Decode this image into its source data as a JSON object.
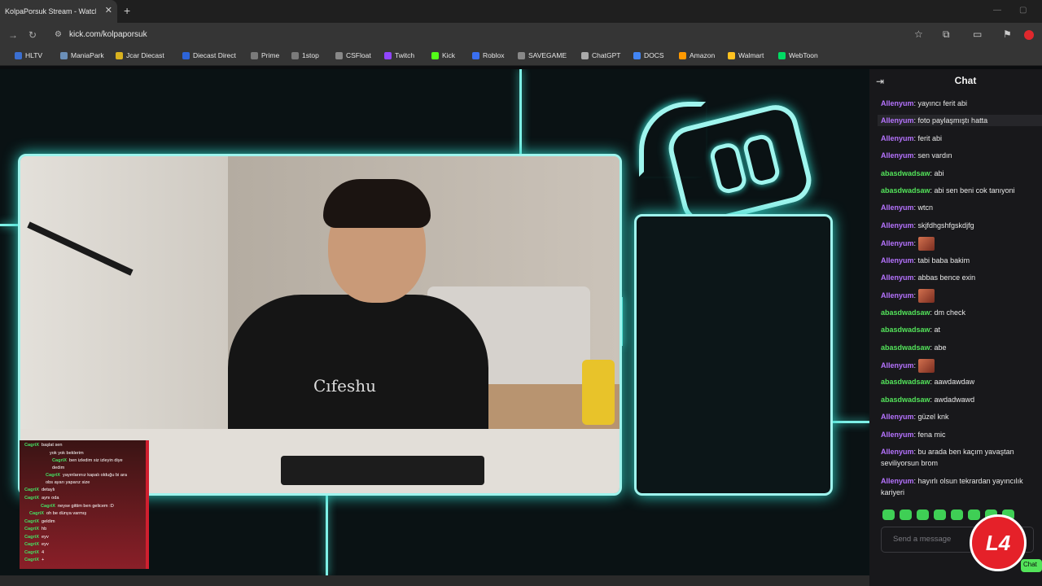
{
  "browser": {
    "tab_title": "KolpaPorsuk Stream - Watch Live",
    "url": "kick.com/kolpaporsuk",
    "bookmarks": [
      "HLTV",
      "ManiaPark",
      "Jcar Diecast",
      "Diecast Direct",
      "Prime",
      "1stop",
      "CSFloat",
      "Twitch",
      "Kick",
      "Roblox",
      "SAVEGAME",
      "ChatGPT",
      "DOCS",
      "Amazon",
      "Walmart",
      "WebToon"
    ],
    "bookmark_colors": [
      "#3b6fd1",
      "#6b8fb8",
      "#d9b21f",
      "#2d64d8",
      "#7a7a7a",
      "#7a7a7a",
      "#888",
      "#9146ff",
      "#53fc18",
      "#3a6ff0",
      "#888",
      "#aaa",
      "#4285f4",
      "#ff9900",
      "#ffc220",
      "#00dc64"
    ]
  },
  "overlay_chat": [
    {
      "user": "CagriX",
      "text": "başlat sen"
    },
    {
      "user": "",
      "text": "yok yok beklerim"
    },
    {
      "user": "CagriX",
      "text": "ben izledim siz izleyin diye dedim"
    },
    {
      "user": "CagriX",
      "text": "yayınlarınız kapalı olduğu bi ara obs ayarı yaparız size"
    },
    {
      "user": "CagriX",
      "text": "detaylı"
    },
    {
      "user": "CagriX",
      "text": "aynı oda"
    },
    {
      "user": "CagriX",
      "text": "neyse gittim ben gelicem :D"
    },
    {
      "user": "CagriX",
      "text": "oh be dünya varmış"
    },
    {
      "user": "CagriX",
      "text": "geldim"
    },
    {
      "user": "CagriX",
      "text": "hb"
    },
    {
      "user": "CagriX",
      "text": "eyv"
    },
    {
      "user": "CagriX",
      "text": "eyv"
    },
    {
      "user": "CagriX",
      "text": "4"
    },
    {
      "user": "CagriX",
      "text": "+"
    }
  ],
  "chat": {
    "title": "Chat",
    "placeholder": "Send a message",
    "button_label": "Chat",
    "messages": [
      {
        "user": "Allenyum",
        "color": "purple",
        "text": "yayıncı ferit abi"
      },
      {
        "user": "Allenyum",
        "color": "purple",
        "text": "foto paylaşmıştı hatta"
      },
      {
        "user": "Allenyum",
        "color": "purple",
        "text": "ferit abi"
      },
      {
        "user": "Allenyum",
        "color": "purple",
        "text": "sen vardın"
      },
      {
        "user": "abasdwadsaw",
        "color": "green",
        "text": "abi"
      },
      {
        "user": "abasdwadsaw",
        "color": "green",
        "text": "abi sen beni cok tanıyoni"
      },
      {
        "user": "Allenyum",
        "color": "purple",
        "text": "wtcn"
      },
      {
        "user": "Allenyum",
        "color": "purple",
        "text": "skjfdhgshfgskdjfg"
      },
      {
        "user": "Allenyum",
        "color": "purple",
        "text": "",
        "emote": true
      },
      {
        "user": "Allenyum",
        "color": "purple",
        "text": "tabi baba bakim"
      },
      {
        "user": "Allenyum",
        "color": "purple",
        "text": "abbas bence exin"
      },
      {
        "user": "Allenyum",
        "color": "purple",
        "text": "",
        "emote": true
      },
      {
        "user": "abasdwadsaw",
        "color": "green",
        "text": "dm check"
      },
      {
        "user": "abasdwadsaw",
        "color": "green",
        "text": "at"
      },
      {
        "user": "abasdwadsaw",
        "color": "green",
        "text": "abe"
      },
      {
        "user": "Allenyum",
        "color": "purple",
        "text": "",
        "emote": true
      },
      {
        "user": "abasdwadsaw",
        "color": "green",
        "text": "aawdawdaw"
      },
      {
        "user": "abasdwadsaw",
        "color": "green",
        "text": "awdadwawd"
      },
      {
        "user": "Allenyum",
        "color": "purple",
        "text": "güzel knk"
      },
      {
        "user": "Allenyum",
        "color": "purple",
        "text": "fena mic"
      },
      {
        "user": "Allenyum",
        "color": "purple",
        "text": "bu arada ben kaçım yavaştan seviliyorsun brom"
      },
      {
        "user": "Allenyum",
        "color": "purple",
        "text": "hayırlı olsun tekrardan yayıncılık kariyeri"
      }
    ]
  },
  "stream": {
    "shirt_print": "Cıfeshu",
    "brand_badge": "L4"
  }
}
